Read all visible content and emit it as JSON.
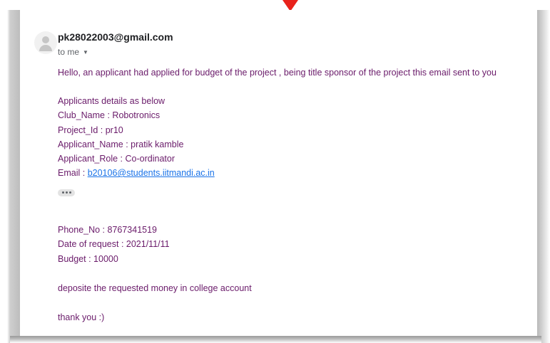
{
  "email": {
    "sender": "pk28022003@gmail.com",
    "recipient_label": "to me",
    "body": {
      "intro": "Hello, an applicant had applied for budget of the project , being title sponsor of the project this email sent to you",
      "details_heading": "Applicants details as below",
      "club_name": "Club_Name : Robotronics",
      "project_id": "Project_Id : pr10",
      "applicant_name": "Applicant_Name : pratik kamble",
      "applicant_role": "Applicant_Role : Co-ordinator",
      "email_prefix": "Email : ",
      "email_link": "b20106@students.iitmandi.ac.in",
      "phone": "Phone_No : 8767341519",
      "date_of_request": "Date of request : 2021/11/11",
      "budget": "Budget : 10000",
      "instruction": "deposite the requested money in college account",
      "closing": "thank you :)"
    }
  },
  "icons": {
    "avatar": "person-avatar-icon",
    "recipient_toggle": "caret-down-icon",
    "trimmed_content": "ellipsis-icon",
    "annotation": "red-triangle-pointer"
  },
  "colors": {
    "body_text": "#6a1b6a",
    "link": "#1a73e8",
    "pointer": "#e8221b",
    "sender_text": "#202124",
    "secondary_text": "#5f6368"
  }
}
